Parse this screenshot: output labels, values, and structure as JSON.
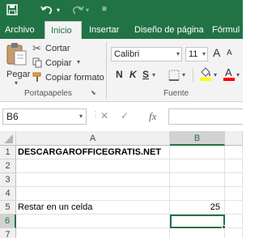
{
  "qat": {
    "save_icon": "save-icon",
    "undo_icon": "undo-icon",
    "redo_icon": "redo-icon"
  },
  "tabs": [
    {
      "label": "Archivo",
      "active": false
    },
    {
      "label": "Inicio",
      "active": true
    },
    {
      "label": "Insertar",
      "active": false
    },
    {
      "label": "Diseño de página",
      "active": false
    },
    {
      "label": "Fórmul",
      "active": false
    }
  ],
  "ribbon": {
    "clipboard": {
      "paste_label": "Pegar",
      "cut_label": "Cortar",
      "copy_label": "Copiar",
      "format_painter_label": "Copiar formato",
      "group_label": "Portapapeles"
    },
    "font": {
      "name": "Calibri",
      "size": "11",
      "bold": "N",
      "italic": "K",
      "underline": "S",
      "grow": "A",
      "shrink": "A",
      "font_color_letter": "A",
      "group_label": "Fuente",
      "highlight_color": "#ffff00",
      "font_color": "#ff0000"
    }
  },
  "formula_bar": {
    "name_box": "B6",
    "cancel": "✕",
    "enter": "✓",
    "fx": "fx",
    "value": ""
  },
  "sheet": {
    "columns": [
      {
        "label": "A",
        "selected": false
      },
      {
        "label": "B",
        "selected": true
      }
    ],
    "rows": [
      {
        "num": "1",
        "a": "DESCARGAROFFICEGRATIS.NET",
        "b": "",
        "a_bold": true
      },
      {
        "num": "2",
        "a": "",
        "b": ""
      },
      {
        "num": "3",
        "a": "",
        "b": ""
      },
      {
        "num": "4",
        "a": "",
        "b": ""
      },
      {
        "num": "5",
        "a": "Restar en un celda",
        "b": "25"
      },
      {
        "num": "6",
        "a": "",
        "b": "",
        "selected": true
      },
      {
        "num": "7",
        "a": "",
        "b": ""
      }
    ]
  },
  "colors": {
    "accent": "#217346"
  }
}
